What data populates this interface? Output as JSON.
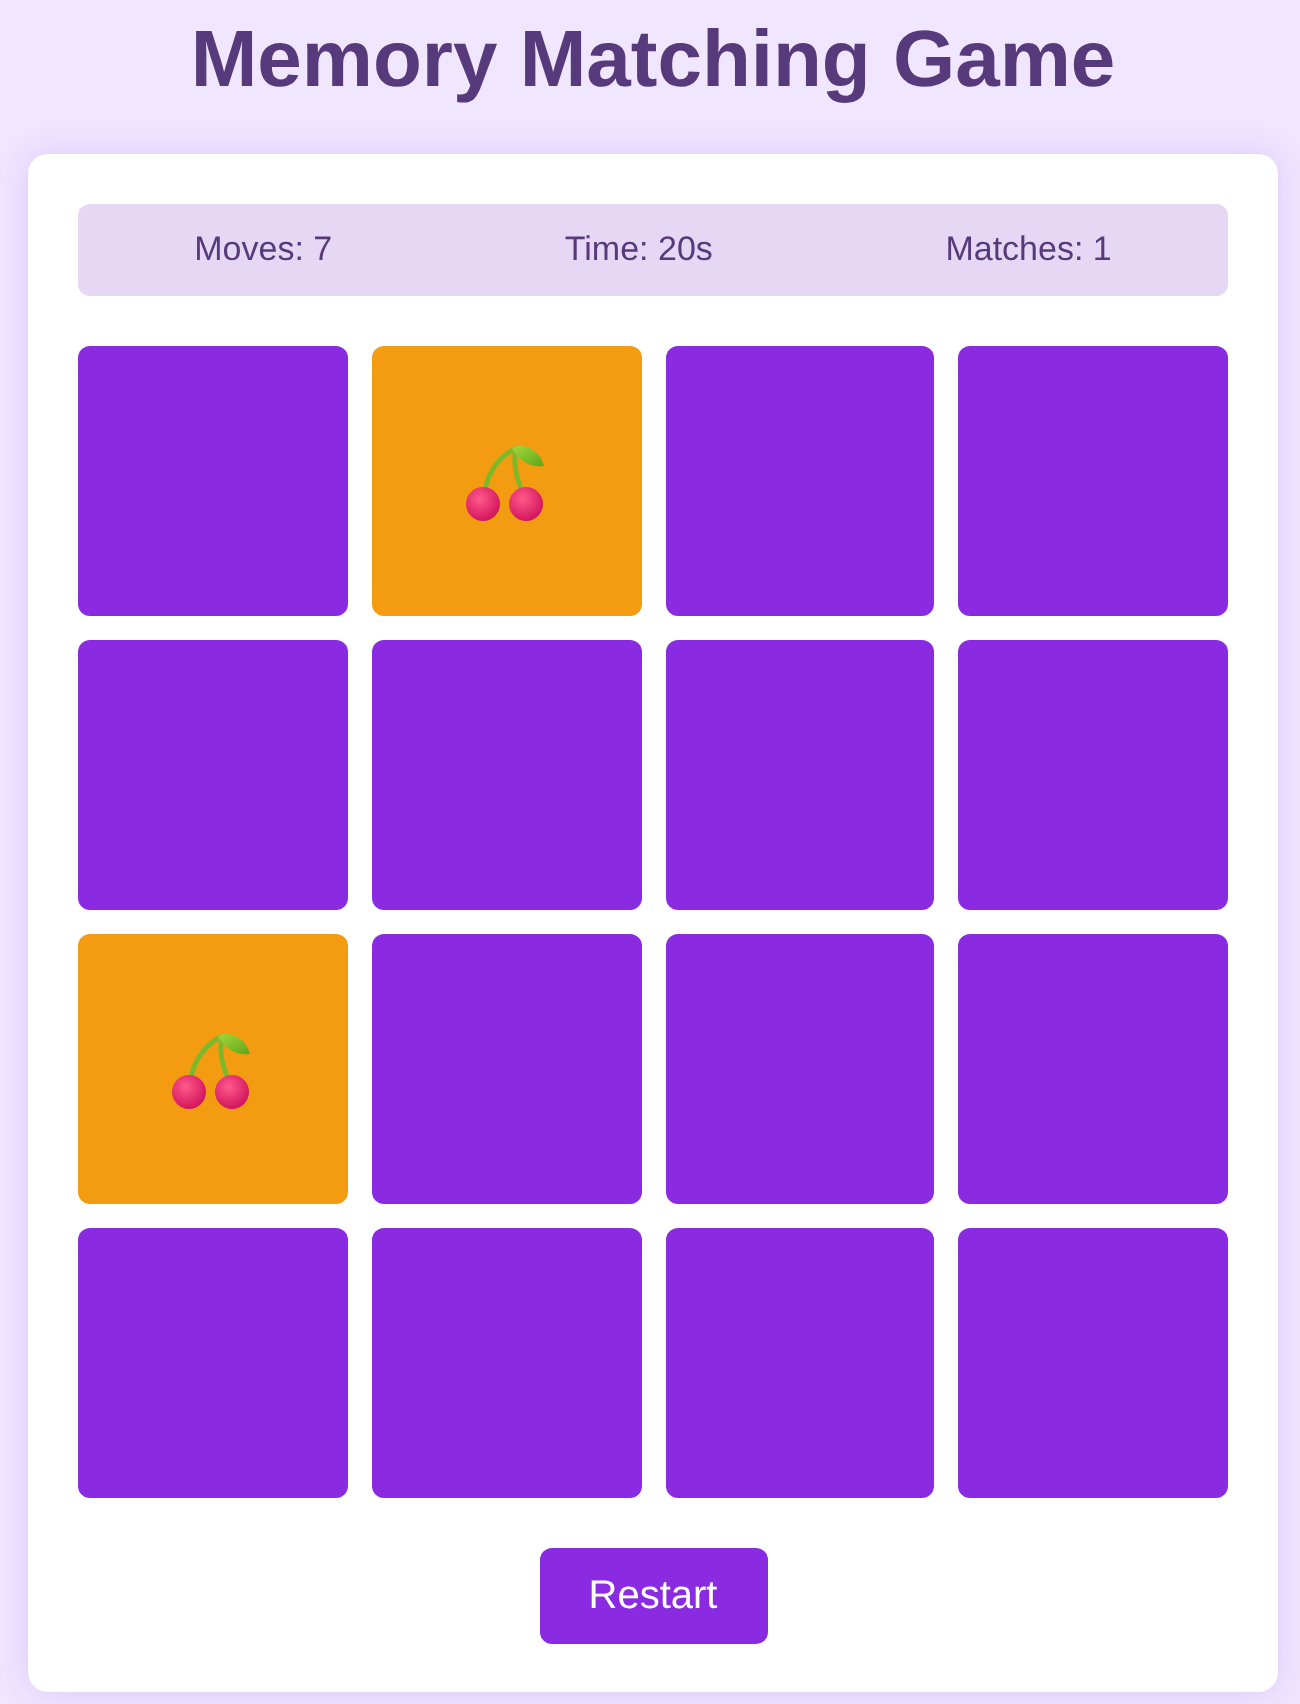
{
  "title": "Memory Matching Game",
  "stats": [
    {
      "text": "Moves: 7"
    },
    {
      "text": "Time: 20s"
    },
    {
      "text": "Matches: 1"
    }
  ],
  "cards": [
    {
      "face_up": false
    },
    {
      "face_up": true
    },
    {
      "face_up": false
    },
    {
      "face_up": false
    },
    {
      "face_up": false
    },
    {
      "face_up": false
    },
    {
      "face_up": false
    },
    {
      "face_up": false
    },
    {
      "face_up": true
    },
    {
      "face_up": false
    },
    {
      "face_up": false
    },
    {
      "face_up": false
    },
    {
      "face_up": false
    },
    {
      "face_up": false
    },
    {
      "face_up": false
    },
    {
      "face_up": false
    }
  ],
  "restart_button": {
    "label": "Restart"
  }
}
